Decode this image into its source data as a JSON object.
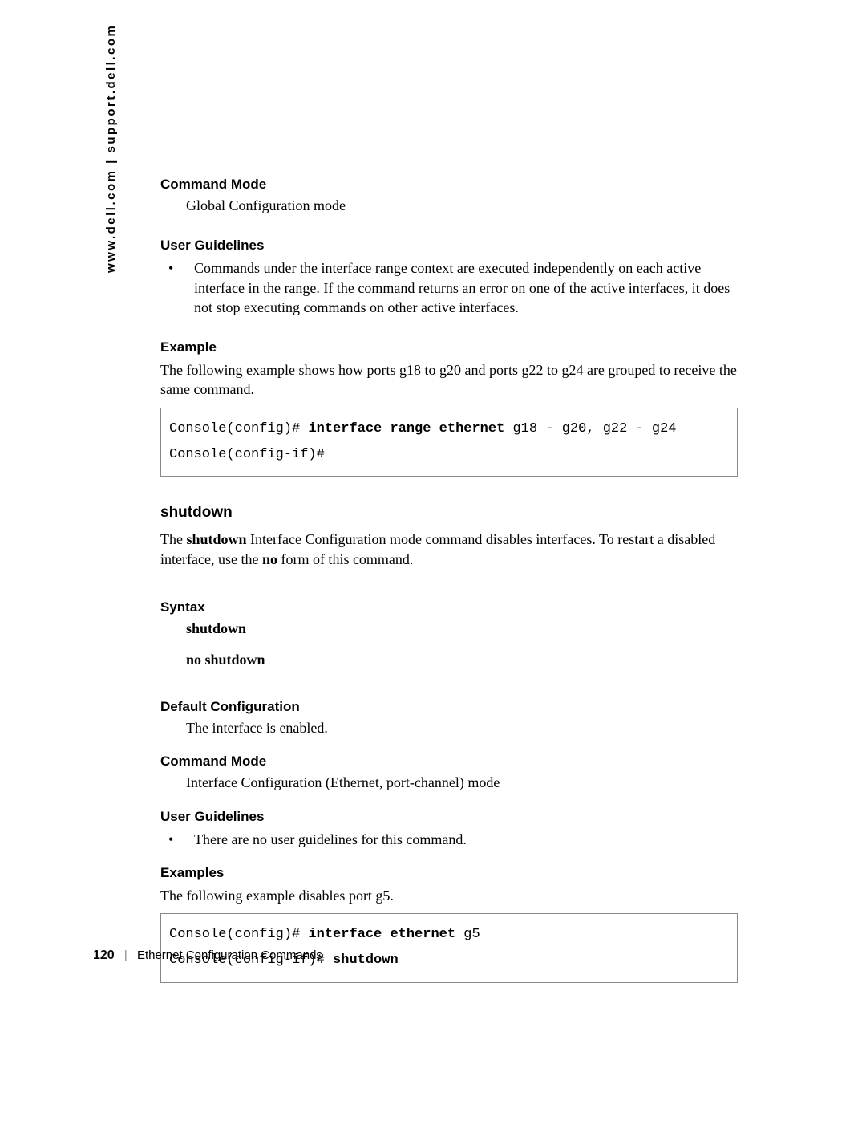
{
  "sidebar": {
    "text": "www.dell.com | support.dell.com"
  },
  "s1": {
    "h_cmdmode": "Command Mode",
    "cmdmode_body": "Global Configuration mode",
    "h_userg": "User Guidelines",
    "userg_bullet": "Commands under the interface range context are executed independently on each active interface in the range. If the command returns an error on one of the active interfaces, it does not stop executing commands on other active interfaces.",
    "h_example": "Example",
    "example_body": "The following example shows how ports g18 to g20 and ports g22 to g24 are grouped to receive the same command.",
    "code": {
      "l1a": "Console(config)# ",
      "l1b": "interface range ethernet",
      "l1c": " g18 - g20, g22 - g24",
      "l2": "Console(config-if)#"
    }
  },
  "s2": {
    "title": "shutdown",
    "desc_a": "The ",
    "desc_b": "shutdown",
    "desc_c": " Interface Configuration mode command disables interfaces. To restart a disabled interface, use the ",
    "desc_d": "no",
    "desc_e": " form of this command.",
    "h_syntax": "Syntax",
    "syntax1": "shutdown",
    "syntax2": "no shutdown",
    "h_default": "Default Configuration",
    "default_body": "The interface is enabled.",
    "h_cmdmode": "Command Mode",
    "cmdmode_body": "Interface Configuration (Ethernet, port-channel) mode",
    "h_userg": "User Guidelines",
    "userg_bullet": "There are no user guidelines for this command.",
    "h_examples": "Examples",
    "examples_body": "The following example disables port g5.",
    "code": {
      "l1a": "Console(config)# ",
      "l1b": "interface ethernet",
      "l1c": " g5",
      "l2a": "Console(config-if)# ",
      "l2b": "shutdown"
    }
  },
  "footer": {
    "page": "120",
    "chapter": "Ethernet Configuration Commands"
  }
}
